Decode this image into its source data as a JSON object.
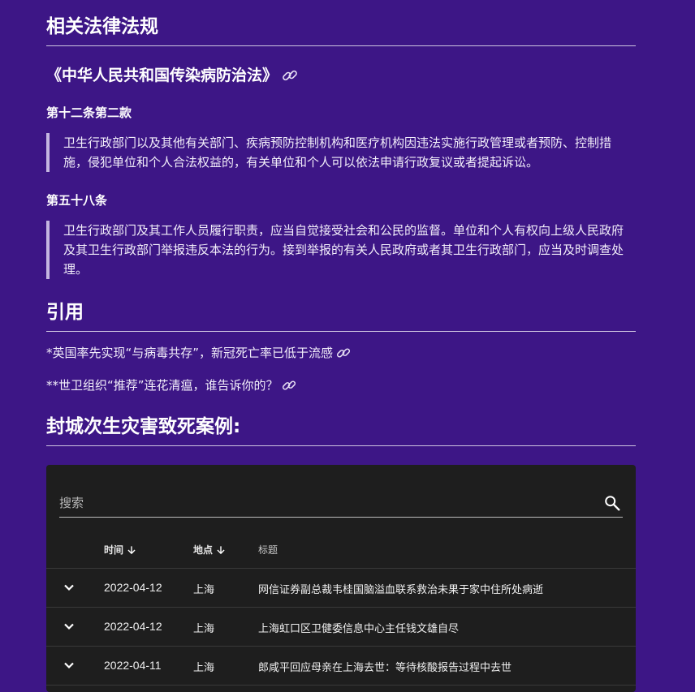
{
  "laws": {
    "heading": "相关法律法规",
    "law_title": "《中华人民共和国传染病防治法》",
    "articles": [
      {
        "title": "第十二条第二款",
        "text": "卫生行政部门以及其他有关部门、疾病预防控制机构和医疗机构因违法实施行政管理或者预防、控制措施，侵犯单位和个人合法权益的，有关单位和个人可以依法申请行政复议或者提起诉讼。"
      },
      {
        "title": "第五十八条",
        "text": "卫生行政部门及其工作人员履行职责，应当自觉接受社会和公民的监督。单位和个人有权向上级人民政府及其卫生行政部门举报违反本法的行为。接到举报的有关人民政府或者其卫生行政部门，应当及时调查处理。"
      }
    ]
  },
  "references": {
    "heading": "引用",
    "items": [
      "*英国率先实现“与病毒共存”，新冠死亡率已低于流感",
      "**世卫组织“推荐”连花清瘟，谁告诉你的？"
    ]
  },
  "cases": {
    "heading": "封城次生灾害致死案例:",
    "search_placeholder": "搜索",
    "columns": [
      "时间",
      "地点",
      "标题"
    ],
    "rows": [
      {
        "date": "2022-04-12",
        "place": "上海",
        "title": "网信证券副总裁韦桂国脑溢血联系救治未果于家中住所处病逝"
      },
      {
        "date": "2022-04-12",
        "place": "上海",
        "title": "上海虹口区卫健委信息中心主任钱文雄自尽"
      },
      {
        "date": "2022-04-11",
        "place": "上海",
        "title": "郎咸平回应母亲在上海去世：等待核酸报告过程中去世"
      }
    ]
  },
  "colors": {
    "background": "#3d1686",
    "table_background": "#1e1e1e",
    "text": "#ffffff"
  },
  "icons": {
    "link": "link-icon",
    "search": "search-icon",
    "sort": "arrow-down-icon",
    "expand": "chevron-down-icon"
  }
}
